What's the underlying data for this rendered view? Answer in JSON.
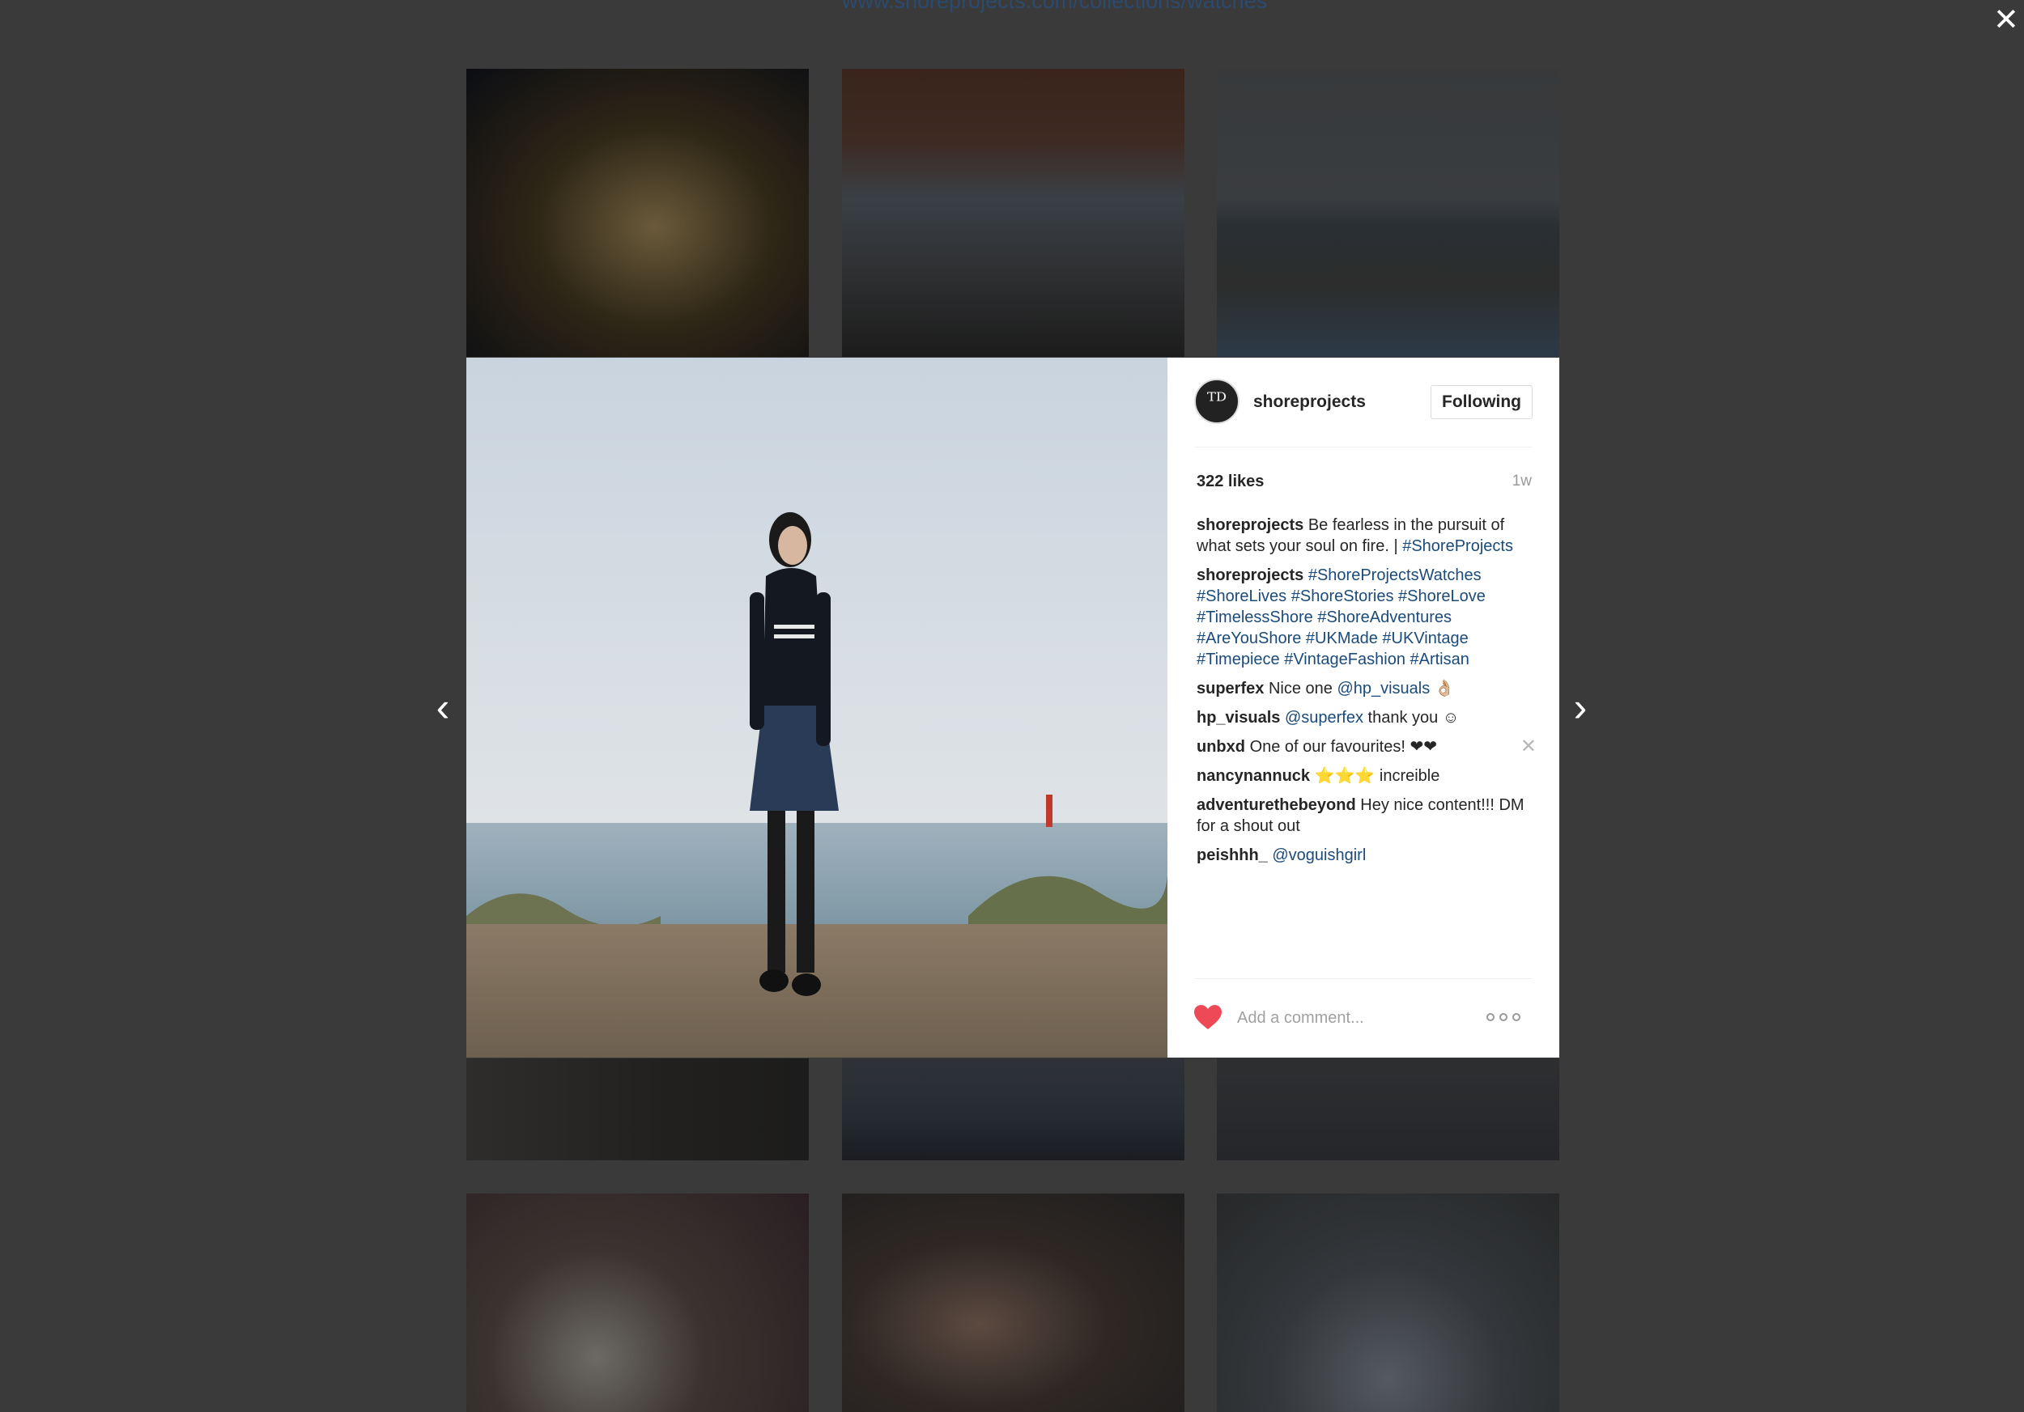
{
  "background": {
    "url_text": "www.shoreprojects.com/collections/watches"
  },
  "lightbox": {
    "close_glyph": "✕",
    "prev_glyph": "‹",
    "next_glyph": "›"
  },
  "post": {
    "username": "shoreprojects",
    "avatar_glyph": "ᵀᴰ",
    "follow_label": "Following",
    "likes": "322 likes",
    "age": "1w",
    "comments": [
      {
        "user": "shoreprojects",
        "text": "Be fearless in the pursuit of what sets your soul on fire. |",
        "tags": "#ShoreProjects"
      },
      {
        "user": "shoreprojects",
        "text": "",
        "tags": "#ShoreProjectsWatches #ShoreLives #ShoreStories #ShoreLove #TimelessShore #ShoreAdventures #AreYouShore #UKMade #UKVintage #Timepiece #VintageFashion #Artisan"
      },
      {
        "user": "superfex",
        "text": "Nice one",
        "tags": "@hp_visuals",
        "suffix": "👌🏼"
      },
      {
        "user": "hp_visuals",
        "text": "",
        "tags": "@superfex",
        "suffix": "thank you ☺"
      },
      {
        "user": "unbxd",
        "text": "One of our favourites! ❤❤",
        "tags": "",
        "delete_glyph": "✕"
      },
      {
        "user": "nancynannuck",
        "text": "⭐⭐⭐ increible",
        "tags": ""
      },
      {
        "user": "adventurethebeyond",
        "text": "Hey nice content!!! DM for a shout out",
        "tags": ""
      },
      {
        "user": "peishhh_",
        "text": "",
        "tags": "@voguishgirl"
      }
    ],
    "comment_placeholder": "Add a comment...",
    "like_icon": "heart-icon",
    "like_color": "#ed4956",
    "more_icon": "more-options-icon"
  }
}
